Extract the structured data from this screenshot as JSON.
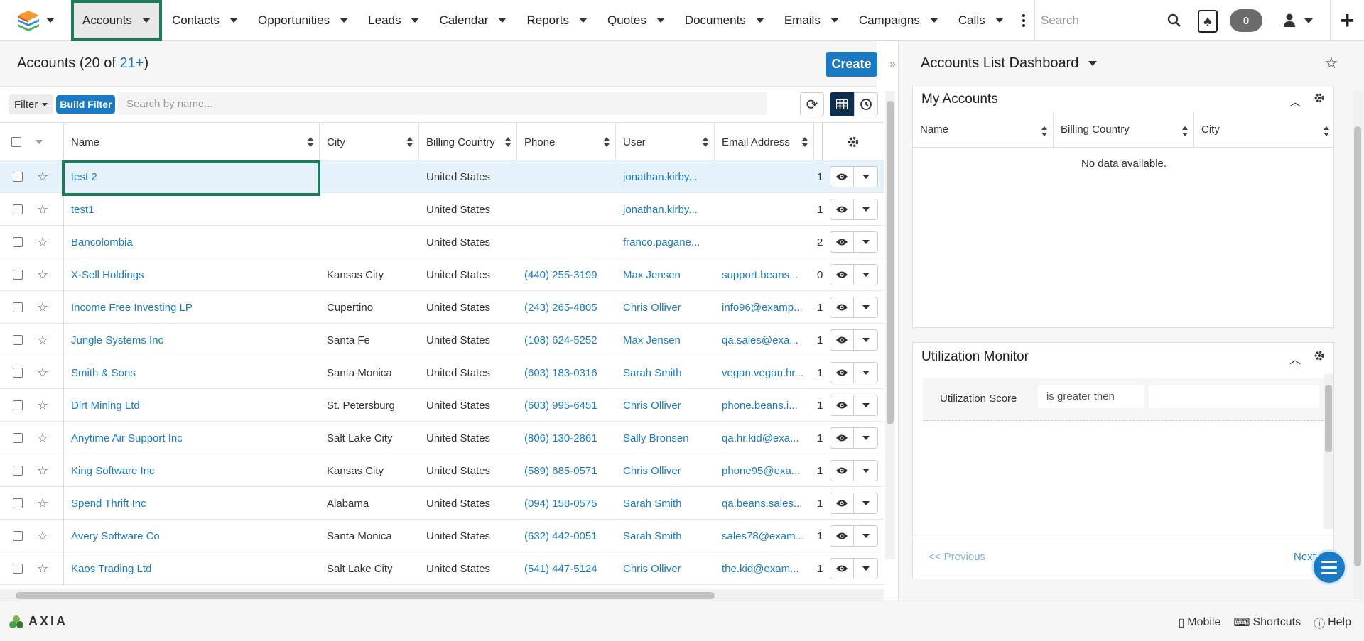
{
  "nav": {
    "items": [
      {
        "label": "Accounts",
        "active": true
      },
      {
        "label": "Contacts"
      },
      {
        "label": "Opportunities"
      },
      {
        "label": "Leads"
      },
      {
        "label": "Calendar"
      },
      {
        "label": "Reports"
      },
      {
        "label": "Quotes"
      },
      {
        "label": "Documents"
      },
      {
        "label": "Emails"
      },
      {
        "label": "Campaigns"
      },
      {
        "label": "Calls"
      }
    ],
    "search_placeholder": "Search",
    "notification_count": "0"
  },
  "list": {
    "title_prefix": "Accounts (20 of ",
    "title_link": "21+",
    "title_suffix": ")",
    "create_label": "Create",
    "filter_label": "Filter",
    "build_filter_label": "Build Filter",
    "search_placeholder": "Search by name...",
    "columns": [
      "Name",
      "City",
      "Billing Country",
      "Phone",
      "User",
      "Email Address"
    ],
    "rows": [
      {
        "name": "test 2",
        "city": "",
        "country": "United States",
        "phone": "",
        "user": "jonathan.kirby...",
        "email": "",
        "extra": "1"
      },
      {
        "name": "test1",
        "city": "",
        "country": "United States",
        "phone": "",
        "user": "jonathan.kirby...",
        "email": "",
        "extra": "1"
      },
      {
        "name": "Bancolombia",
        "city": "",
        "country": "United States",
        "phone": "",
        "user": "franco.pagane...",
        "email": "",
        "extra": "2"
      },
      {
        "name": "X-Sell Holdings",
        "city": "Kansas City",
        "country": "United States",
        "phone": "(440) 255-3199",
        "user": "Max Jensen",
        "email": "support.beans...",
        "extra": "0"
      },
      {
        "name": "Income Free Investing LP",
        "city": "Cupertino",
        "country": "United States",
        "phone": "(243) 265-4805",
        "user": "Chris Olliver",
        "email": "info96@examp...",
        "extra": "1"
      },
      {
        "name": "Jungle Systems Inc",
        "city": "Santa Fe",
        "country": "United States",
        "phone": "(108) 624-5252",
        "user": "Max Jensen",
        "email": "qa.sales@exa...",
        "extra": "1"
      },
      {
        "name": "Smith & Sons",
        "city": "Santa Monica",
        "country": "United States",
        "phone": "(603) 183-0316",
        "user": "Sarah Smith",
        "email": "vegan.vegan.hr...",
        "extra": "1"
      },
      {
        "name": "Dirt Mining Ltd",
        "city": "St. Petersburg",
        "country": "United States",
        "phone": "(603) 995-6451",
        "user": "Chris Olliver",
        "email": "phone.beans.i...",
        "extra": "1"
      },
      {
        "name": "Anytime Air Support Inc",
        "city": "Salt Lake City",
        "country": "United States",
        "phone": "(806) 130-2861",
        "user": "Sally Bronsen",
        "email": "qa.hr.kid@exa...",
        "extra": "1"
      },
      {
        "name": "King Software Inc",
        "city": "Kansas City",
        "country": "United States",
        "phone": "(589) 685-0571",
        "user": "Chris Olliver",
        "email": "phone95@exa...",
        "extra": "1"
      },
      {
        "name": "Spend Thrift Inc",
        "city": "Alabama",
        "country": "United States",
        "phone": "(094) 158-0575",
        "user": "Sarah Smith",
        "email": "qa.beans.sales...",
        "extra": "1"
      },
      {
        "name": "Avery Software Co",
        "city": "Santa Monica",
        "country": "United States",
        "phone": "(632) 442-0051",
        "user": "Sarah Smith",
        "email": "sales78@exam...",
        "extra": "1"
      },
      {
        "name": "Kaos Trading Ltd",
        "city": "Salt Lake City",
        "country": "United States",
        "phone": "(541) 447-5124",
        "user": "Chris Olliver",
        "email": "the.kid@exam...",
        "extra": "1"
      }
    ]
  },
  "dashboard": {
    "title": "Accounts List Dashboard",
    "my_accounts": {
      "title": "My Accounts",
      "columns": [
        "Name",
        "Billing Country",
        "City"
      ],
      "empty_text": "No data available."
    },
    "utilization": {
      "title": "Utilization Monitor",
      "field_label": "Utilization Score",
      "operator": "is greater then",
      "prev_label": "<< Previous",
      "next_label": "Next >"
    }
  },
  "footer": {
    "brand": "AXIA",
    "mobile_label": "Mobile",
    "shortcuts_label": "Shortcuts",
    "help_label": "Help"
  },
  "colors": {
    "accent": "#1a7bc4",
    "focus_outline": "#1f7a5a",
    "selected_row": "#e6f2fb"
  }
}
